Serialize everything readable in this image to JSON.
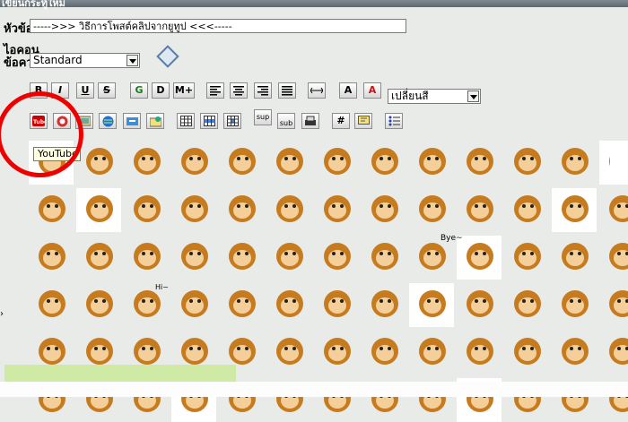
{
  "header": {
    "title": "เขียนกระทู้ใหม่"
  },
  "form": {
    "subject_label": "หัวข้อ:",
    "subject_value": "----->>> วิธีการโพสต์คลิปจากยูทูป <<<-----",
    "icon_label_line1": "ไอคอน",
    "icon_label_line2": "ข้อความ:",
    "icon_select_value": "Standard",
    "color_select_value": "เปลี่ยนสี"
  },
  "toolbar": {
    "row1": [
      {
        "name": "bold",
        "label": "B"
      },
      {
        "name": "italic",
        "label": "I"
      },
      {
        "name": "underline",
        "label": "U"
      },
      {
        "name": "strikethrough",
        "label": "S"
      },
      {
        "name": "glow",
        "label": "G"
      },
      {
        "name": "shadow",
        "label": "D"
      },
      {
        "name": "marquee",
        "label": "M+"
      },
      {
        "name": "align-left",
        "label": ""
      },
      {
        "name": "align-center",
        "label": ""
      },
      {
        "name": "align-right",
        "label": ""
      },
      {
        "name": "justify",
        "label": ""
      },
      {
        "name": "horizontal-rule",
        "label": ""
      },
      {
        "name": "font-size",
        "label": "A"
      },
      {
        "name": "font-color",
        "label": "A"
      }
    ],
    "row2": [
      {
        "name": "youtube",
        "label": "You Tube"
      },
      {
        "name": "flash",
        "label": ""
      },
      {
        "name": "image",
        "label": ""
      },
      {
        "name": "hyperlink",
        "label": ""
      },
      {
        "name": "ftp",
        "label": ""
      },
      {
        "name": "email",
        "label": ""
      },
      {
        "name": "table",
        "label": ""
      },
      {
        "name": "table-row",
        "label": ""
      },
      {
        "name": "table-cell",
        "label": ""
      },
      {
        "name": "superscript",
        "label": "sup"
      },
      {
        "name": "subscript",
        "label": "sub"
      },
      {
        "name": "teletype",
        "label": ""
      },
      {
        "name": "code",
        "label": "#"
      },
      {
        "name": "quote",
        "label": ""
      },
      {
        "name": "list",
        "label": ""
      }
    ]
  },
  "tooltip": {
    "text": "YouTube"
  },
  "smileys": {
    "rows": 6,
    "cols": 13,
    "caption": "Bye~",
    "speech": "Hi~"
  },
  "colors": {
    "highlight_circle": "#e00000",
    "status_bar": "#cfeaa4",
    "page_bg": "#e9ebe8"
  }
}
